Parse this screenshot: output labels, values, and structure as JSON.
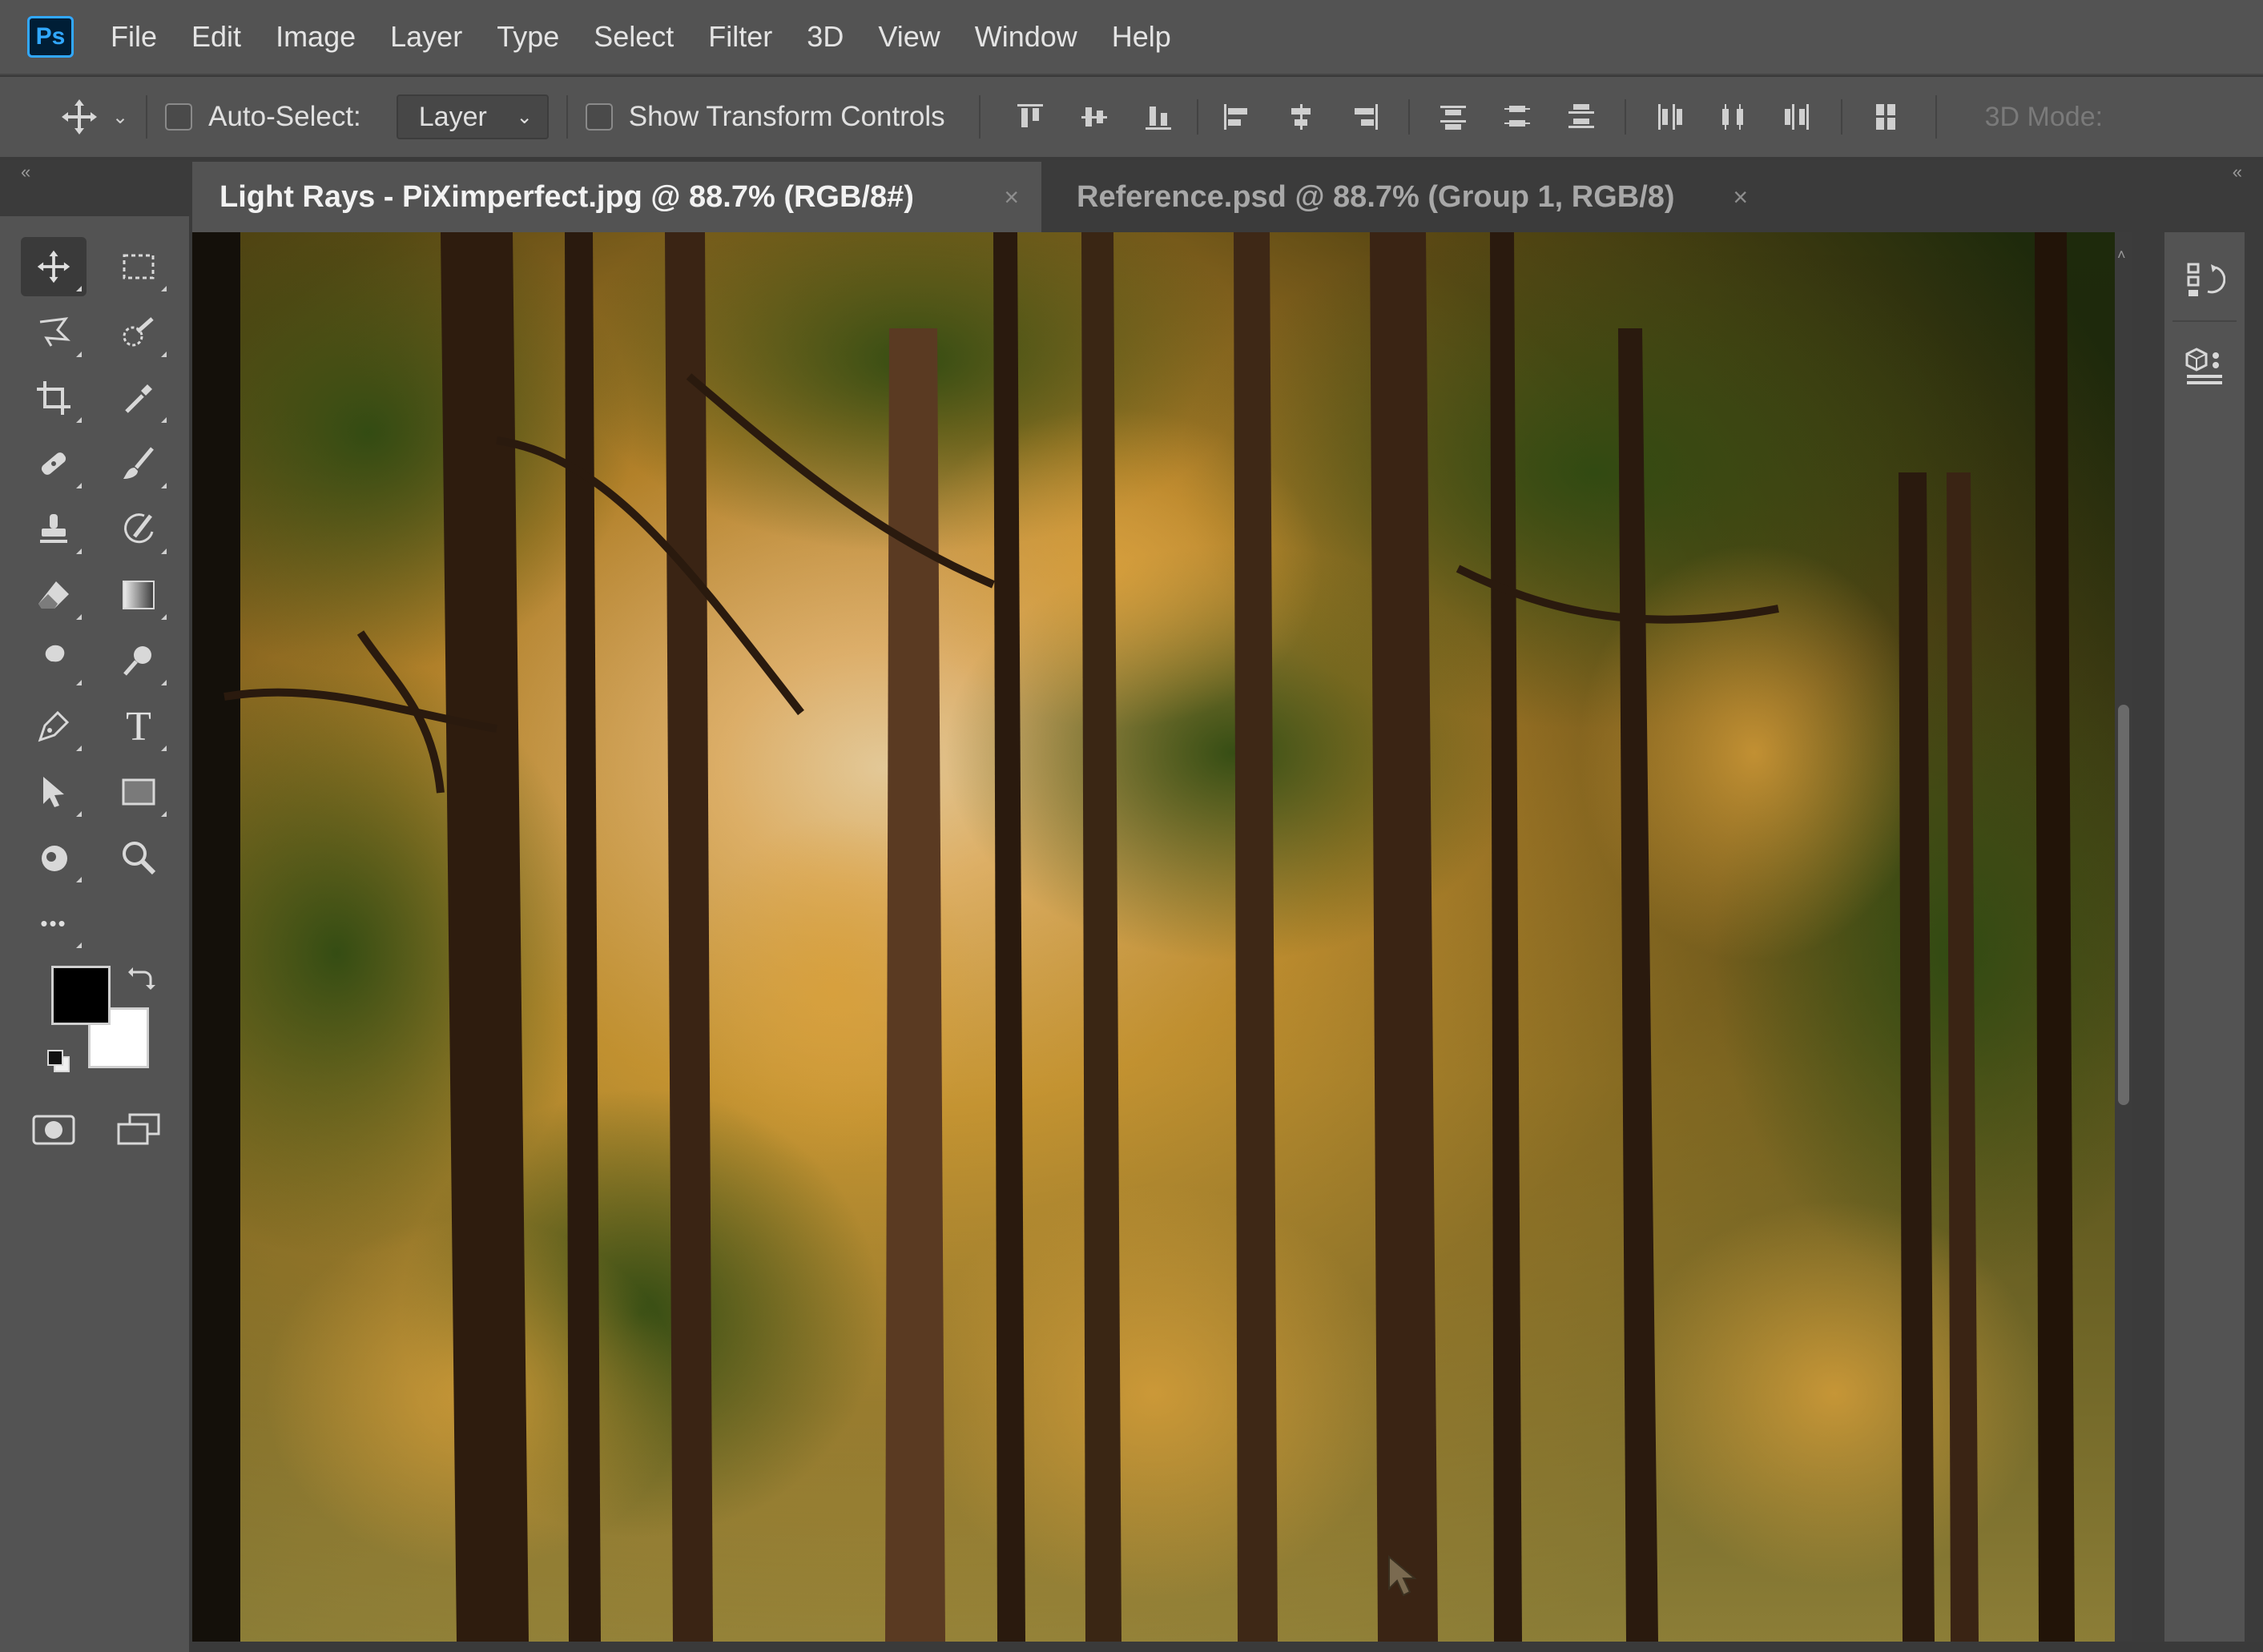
{
  "app": {
    "logo": "Ps"
  },
  "menu": [
    "File",
    "Edit",
    "Image",
    "Layer",
    "Type",
    "Select",
    "Filter",
    "3D",
    "View",
    "Window",
    "Help"
  ],
  "options": {
    "move_icon": "move-icon",
    "auto_select_label": "Auto-Select:",
    "auto_select_checked": false,
    "target_value": "Layer",
    "transform_label": "Show Transform Controls",
    "transform_checked": false,
    "mode3d_label": "3D Mode:"
  },
  "tabs": [
    {
      "title": "Light Rays - PiXimperfect.jpg @ 88.7% (RGB/8#)",
      "active": true,
      "close": "×"
    },
    {
      "title": "Reference.psd @ 88.7% (Group 1, RGB/8)",
      "active": false,
      "close": "×"
    }
  ],
  "tools": [
    "move-tool",
    "rectangular-marquee-tool",
    "polygonal-lasso-tool",
    "quick-selection-tool",
    "crop-tool",
    "eyedropper-tool",
    "spot-healing-brush-tool",
    "brush-tool",
    "clone-stamp-tool",
    "history-brush-tool",
    "eraser-tool",
    "gradient-tool",
    "smudge-tool",
    "dodge-tool",
    "pen-tool",
    "type-tool",
    "path-selection-tool",
    "rectangle-tool",
    "rotate-view-tool",
    "zoom-tool",
    "edit-toolbar"
  ],
  "type_tool_glyph": "T",
  "more_glyph": "•••",
  "colors": {
    "foreground": "#000000",
    "background": "#ffffff",
    "ui": "#535353",
    "accent": "#31a8ff"
  },
  "dock": [
    "history-panel-icon",
    "libraries-panel-icon"
  ]
}
